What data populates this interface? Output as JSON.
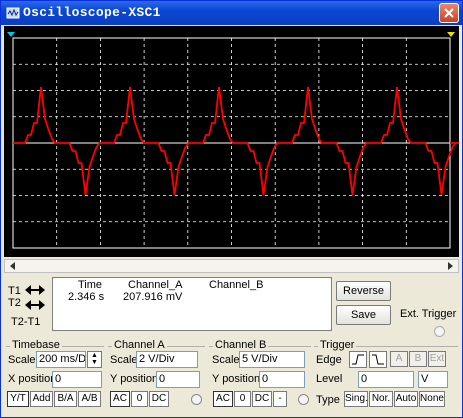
{
  "window": {
    "title": "Oscilloscope-XSC1"
  },
  "readout": {
    "t1_label": "T1",
    "t2_label": "T2",
    "t2t1_label": "T2-T1",
    "time_header": "Time",
    "channel_a_header": "Channel_A",
    "channel_b_header": "Channel_B",
    "time_value": "2.346 s",
    "channel_a_value": "207.916 mV",
    "channel_b_value": ""
  },
  "buttons": {
    "reverse": "Reverse",
    "save": "Save",
    "ext_trigger": "Ext. Trigger"
  },
  "timebase": {
    "title": "Timebase",
    "scale_label": "Scale",
    "scale_value": "200 ms/Div",
    "xpos_label": "X position",
    "xpos_value": "0",
    "modes": [
      "Y/T",
      "Add",
      "B/A",
      "A/B"
    ]
  },
  "channel_a": {
    "title": "Channel A",
    "scale_label": "Scale",
    "scale_value": "2  V/Div",
    "ypos_label": "Y position",
    "ypos_value": "0",
    "coupling": [
      "AC",
      "0",
      "DC"
    ]
  },
  "channel_b": {
    "title": "Channel B",
    "scale_label": "Scale",
    "scale_value": "5  V/Div",
    "ypos_label": "Y position",
    "ypos_value": "0",
    "coupling": [
      "AC",
      "0",
      "DC",
      "-"
    ]
  },
  "trigger": {
    "title": "Trigger",
    "edge_label": "Edge",
    "sources": [
      "A",
      "B",
      "Ext"
    ],
    "level_label": "Level",
    "level_value": "0",
    "level_unit": "V",
    "type_label": "Type",
    "types": [
      "Sing.",
      "Nor.",
      "Auto",
      "None"
    ]
  },
  "colors": {
    "trace": "#ff0000",
    "screen": "#000000",
    "grid": "#ffffff"
  },
  "icons": [
    "oscilloscope-app-icon",
    "close-icon",
    "cursor-t1-marker-icon",
    "cursor-t2-marker-icon",
    "rising-edge-icon",
    "falling-edge-icon"
  ]
}
